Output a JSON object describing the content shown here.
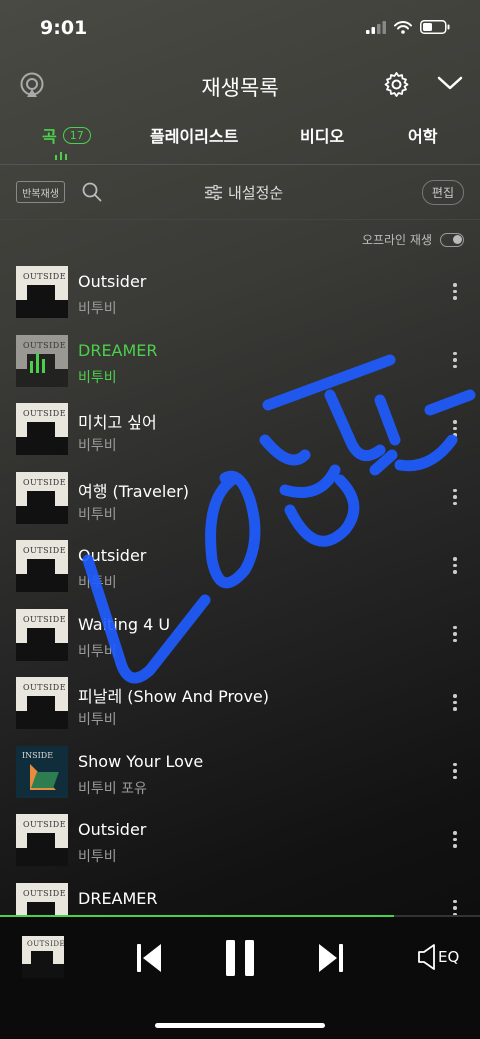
{
  "status_bar": {
    "time": "9:01"
  },
  "header": {
    "title": "재생목록"
  },
  "tabs": [
    {
      "label": "곡",
      "count": "17",
      "active": true
    },
    {
      "label": "플레이리스트"
    },
    {
      "label": "비디오"
    },
    {
      "label": "어학"
    }
  ],
  "toolbar": {
    "repeat_label": "반복재생",
    "sort_label": "내설정순",
    "edit_label": "편집"
  },
  "offline": {
    "label": "오프라인 재생",
    "enabled": false
  },
  "songs": [
    {
      "title": "Outsider",
      "artist": "비투비",
      "album_text": "OUTSIDE"
    },
    {
      "title": "DREAMER",
      "artist": "비투비",
      "album_text": "OUTSIDE",
      "playing": true
    },
    {
      "title": "미치고 싶어",
      "artist": "비투비",
      "album_text": "OUTSIDE"
    },
    {
      "title": "여행 (Traveler)",
      "artist": "비투비",
      "album_text": "OUTSIDE"
    },
    {
      "title": "Outsider",
      "artist": "비투비",
      "album_text": "OUTSIDE"
    },
    {
      "title": "Waiting 4 U",
      "artist": "비투비",
      "album_text": "OUTSIDE"
    },
    {
      "title": "피날레 (Show And Prove)",
      "artist": "비투비",
      "album_text": "OUTSIDE"
    },
    {
      "title": "Show Your Love",
      "artist": "비투비 포유",
      "album_text": "INSIDE"
    },
    {
      "title": "Outsider",
      "artist": "비투비",
      "album_text": "OUTSIDE"
    },
    {
      "title": "DREAMER",
      "artist": "",
      "album_text": "OUTSIDE"
    }
  ],
  "player": {
    "album_text": "OUTSIDE",
    "progress": 0.82,
    "eq_label": "EQ"
  },
  "overlay": {
    "handwriting": "LOVE"
  },
  "colors": {
    "accent": "#4cd04c",
    "scribble": "#1f5cff"
  }
}
